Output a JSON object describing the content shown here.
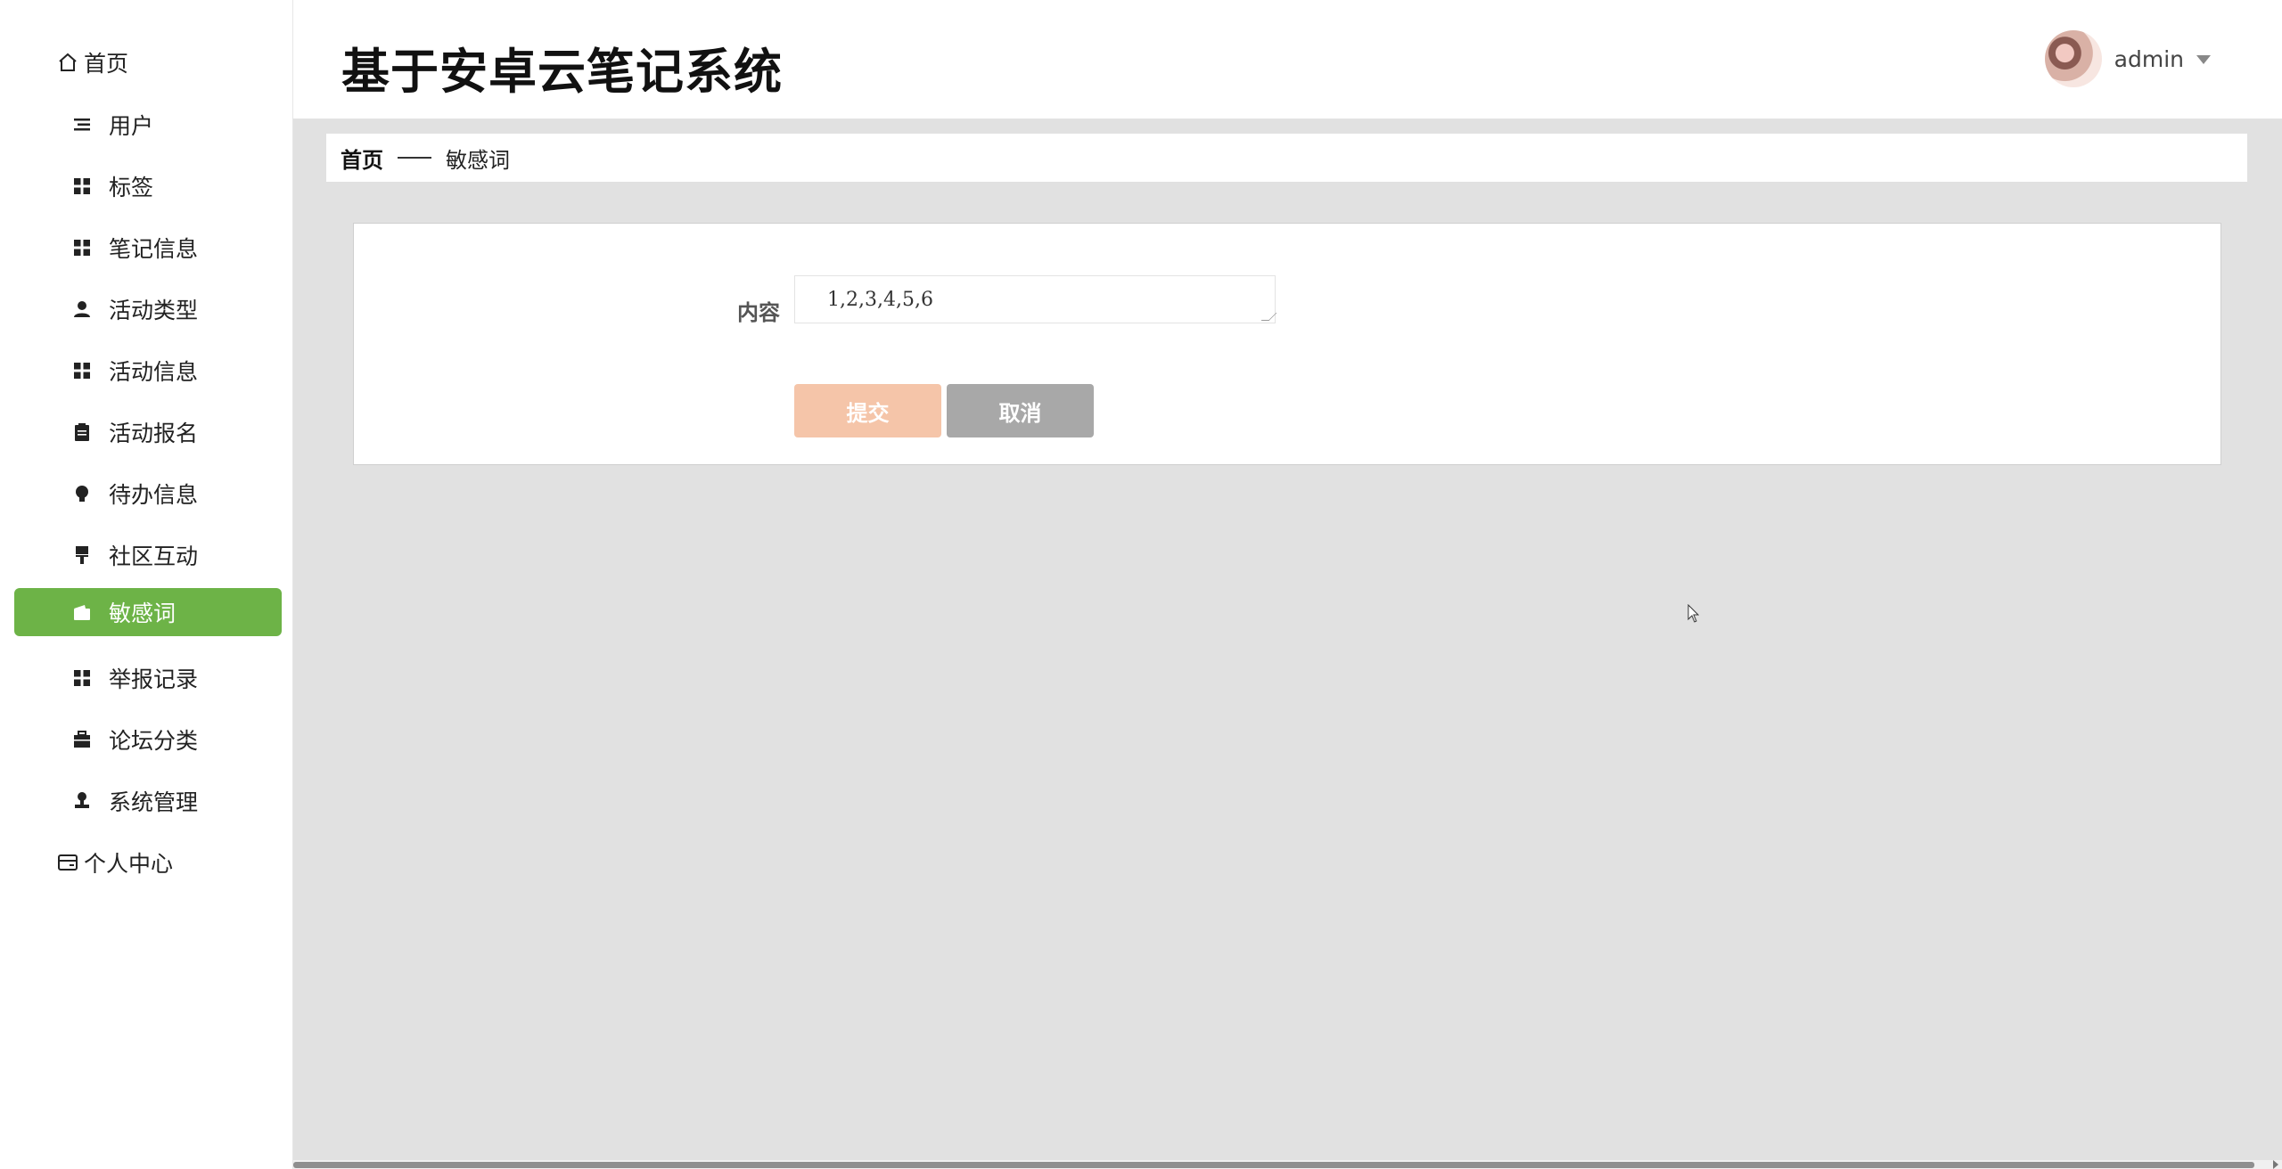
{
  "app": {
    "title": "基于安卓云笔记系统"
  },
  "user": {
    "name": "admin"
  },
  "sidebar": {
    "items": [
      {
        "label": "首页",
        "icon": "home-icon"
      },
      {
        "label": "用户",
        "icon": "list-icon"
      },
      {
        "label": "标签",
        "icon": "grid-icon"
      },
      {
        "label": "笔记信息",
        "icon": "grid-icon"
      },
      {
        "label": "活动类型",
        "icon": "user-icon"
      },
      {
        "label": "活动信息",
        "icon": "grid-icon"
      },
      {
        "label": "活动报名",
        "icon": "clipboard-icon"
      },
      {
        "label": "待办信息",
        "icon": "bulb-icon"
      },
      {
        "label": "社区互动",
        "icon": "brush-icon"
      },
      {
        "label": "敏感词",
        "icon": "wallet-icon",
        "active": true
      },
      {
        "label": "举报记录",
        "icon": "grid-icon"
      },
      {
        "label": "论坛分类",
        "icon": "briefcase-icon"
      },
      {
        "label": "系统管理",
        "icon": "stamp-icon"
      },
      {
        "label": "个人中心",
        "icon": "card-icon"
      }
    ],
    "active_color": "#6db347"
  },
  "breadcrumb": {
    "home": "首页",
    "current": "敏感词"
  },
  "form": {
    "content_label": "内容",
    "content_value": "1,2,3,4,5,6",
    "submit_label": "提交",
    "cancel_label": "取消",
    "submit_color": "#f5c5a9",
    "cancel_color": "#a8a8a8"
  }
}
